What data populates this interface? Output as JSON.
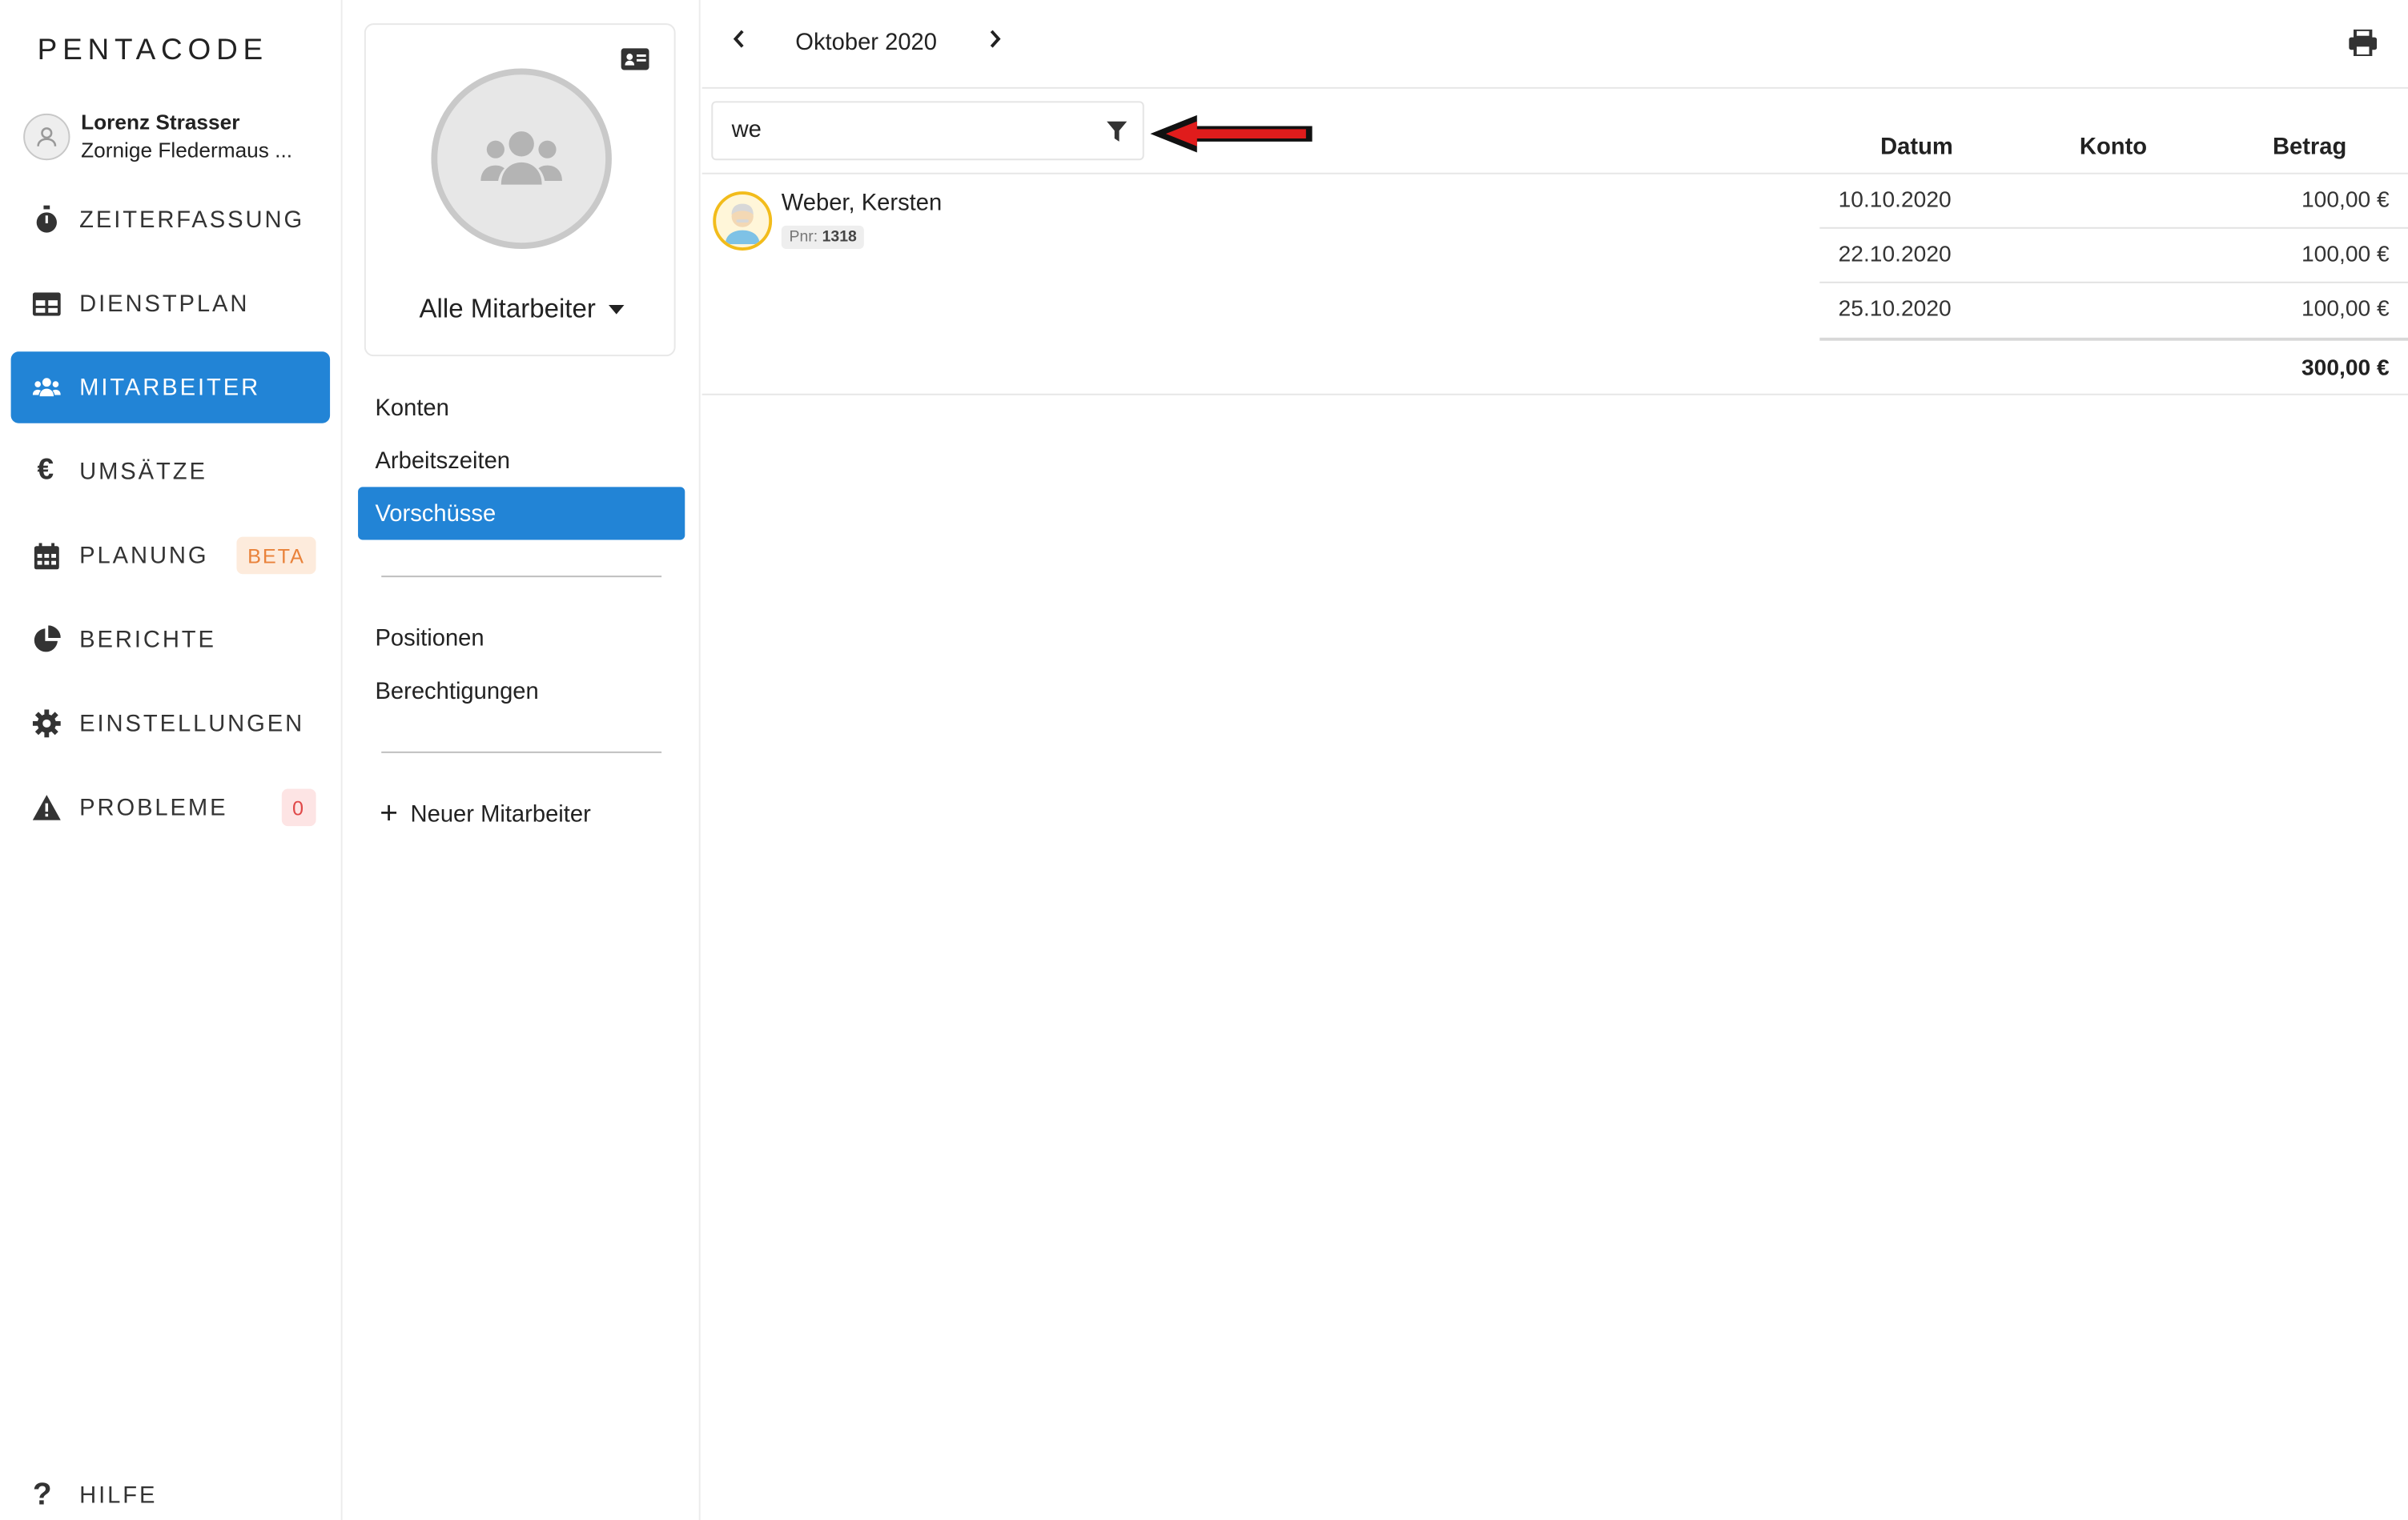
{
  "app": {
    "logo": "PENTACODE"
  },
  "user": {
    "name": "Lorenz Strasser",
    "subtitle": "Zornige Fledermaus ..."
  },
  "nav": {
    "items": [
      {
        "label": "ZEITERFASSUNG",
        "icon": "stopwatch-icon"
      },
      {
        "label": "DIENSTPLAN",
        "icon": "table-icon"
      },
      {
        "label": "MITARBEITER",
        "icon": "users-icon",
        "active": true
      },
      {
        "label": "UMSÄTZE",
        "icon": "euro-icon"
      },
      {
        "label": "PLANUNG",
        "icon": "calendar-icon",
        "badge": "BETA"
      },
      {
        "label": "BERICHTE",
        "icon": "pie-chart-icon"
      },
      {
        "label": "EINSTELLUNGEN",
        "icon": "gear-icon"
      },
      {
        "label": "PROBLEME",
        "icon": "warning-icon",
        "badge": "0"
      }
    ],
    "help": "HILFE"
  },
  "group": {
    "selected": "Alle Mitarbeiter"
  },
  "submenu": {
    "items": [
      "Konten",
      "Arbeitszeiten",
      "Vorschüsse"
    ],
    "active": "Vorschüsse",
    "items2": [
      "Positionen",
      "Berechtigungen"
    ],
    "new_employee": "Neuer Mitarbeiter"
  },
  "toolbar": {
    "month": "Oktober 2020"
  },
  "filter": {
    "value": "we"
  },
  "table": {
    "headers": {
      "date": "Datum",
      "account": "Konto",
      "amount": "Betrag"
    },
    "employee": {
      "name": "Weber, Kersten",
      "pnr_label": "Pnr:",
      "pnr": "1318"
    },
    "rows": [
      {
        "date": "10.10.2020",
        "account": "",
        "amount": "100,00 €"
      },
      {
        "date": "22.10.2020",
        "account": "",
        "amount": "100,00 €"
      },
      {
        "date": "25.10.2020",
        "account": "",
        "amount": "100,00 €"
      }
    ],
    "total": "300,00 €"
  },
  "colors": {
    "accent": "#2284d6",
    "beta_bg": "#fdebdc",
    "beta_text": "#e9823a",
    "problem_bg": "#fde4e4",
    "problem_text": "#e04848",
    "annotation_arrow": "#e01c1c"
  }
}
